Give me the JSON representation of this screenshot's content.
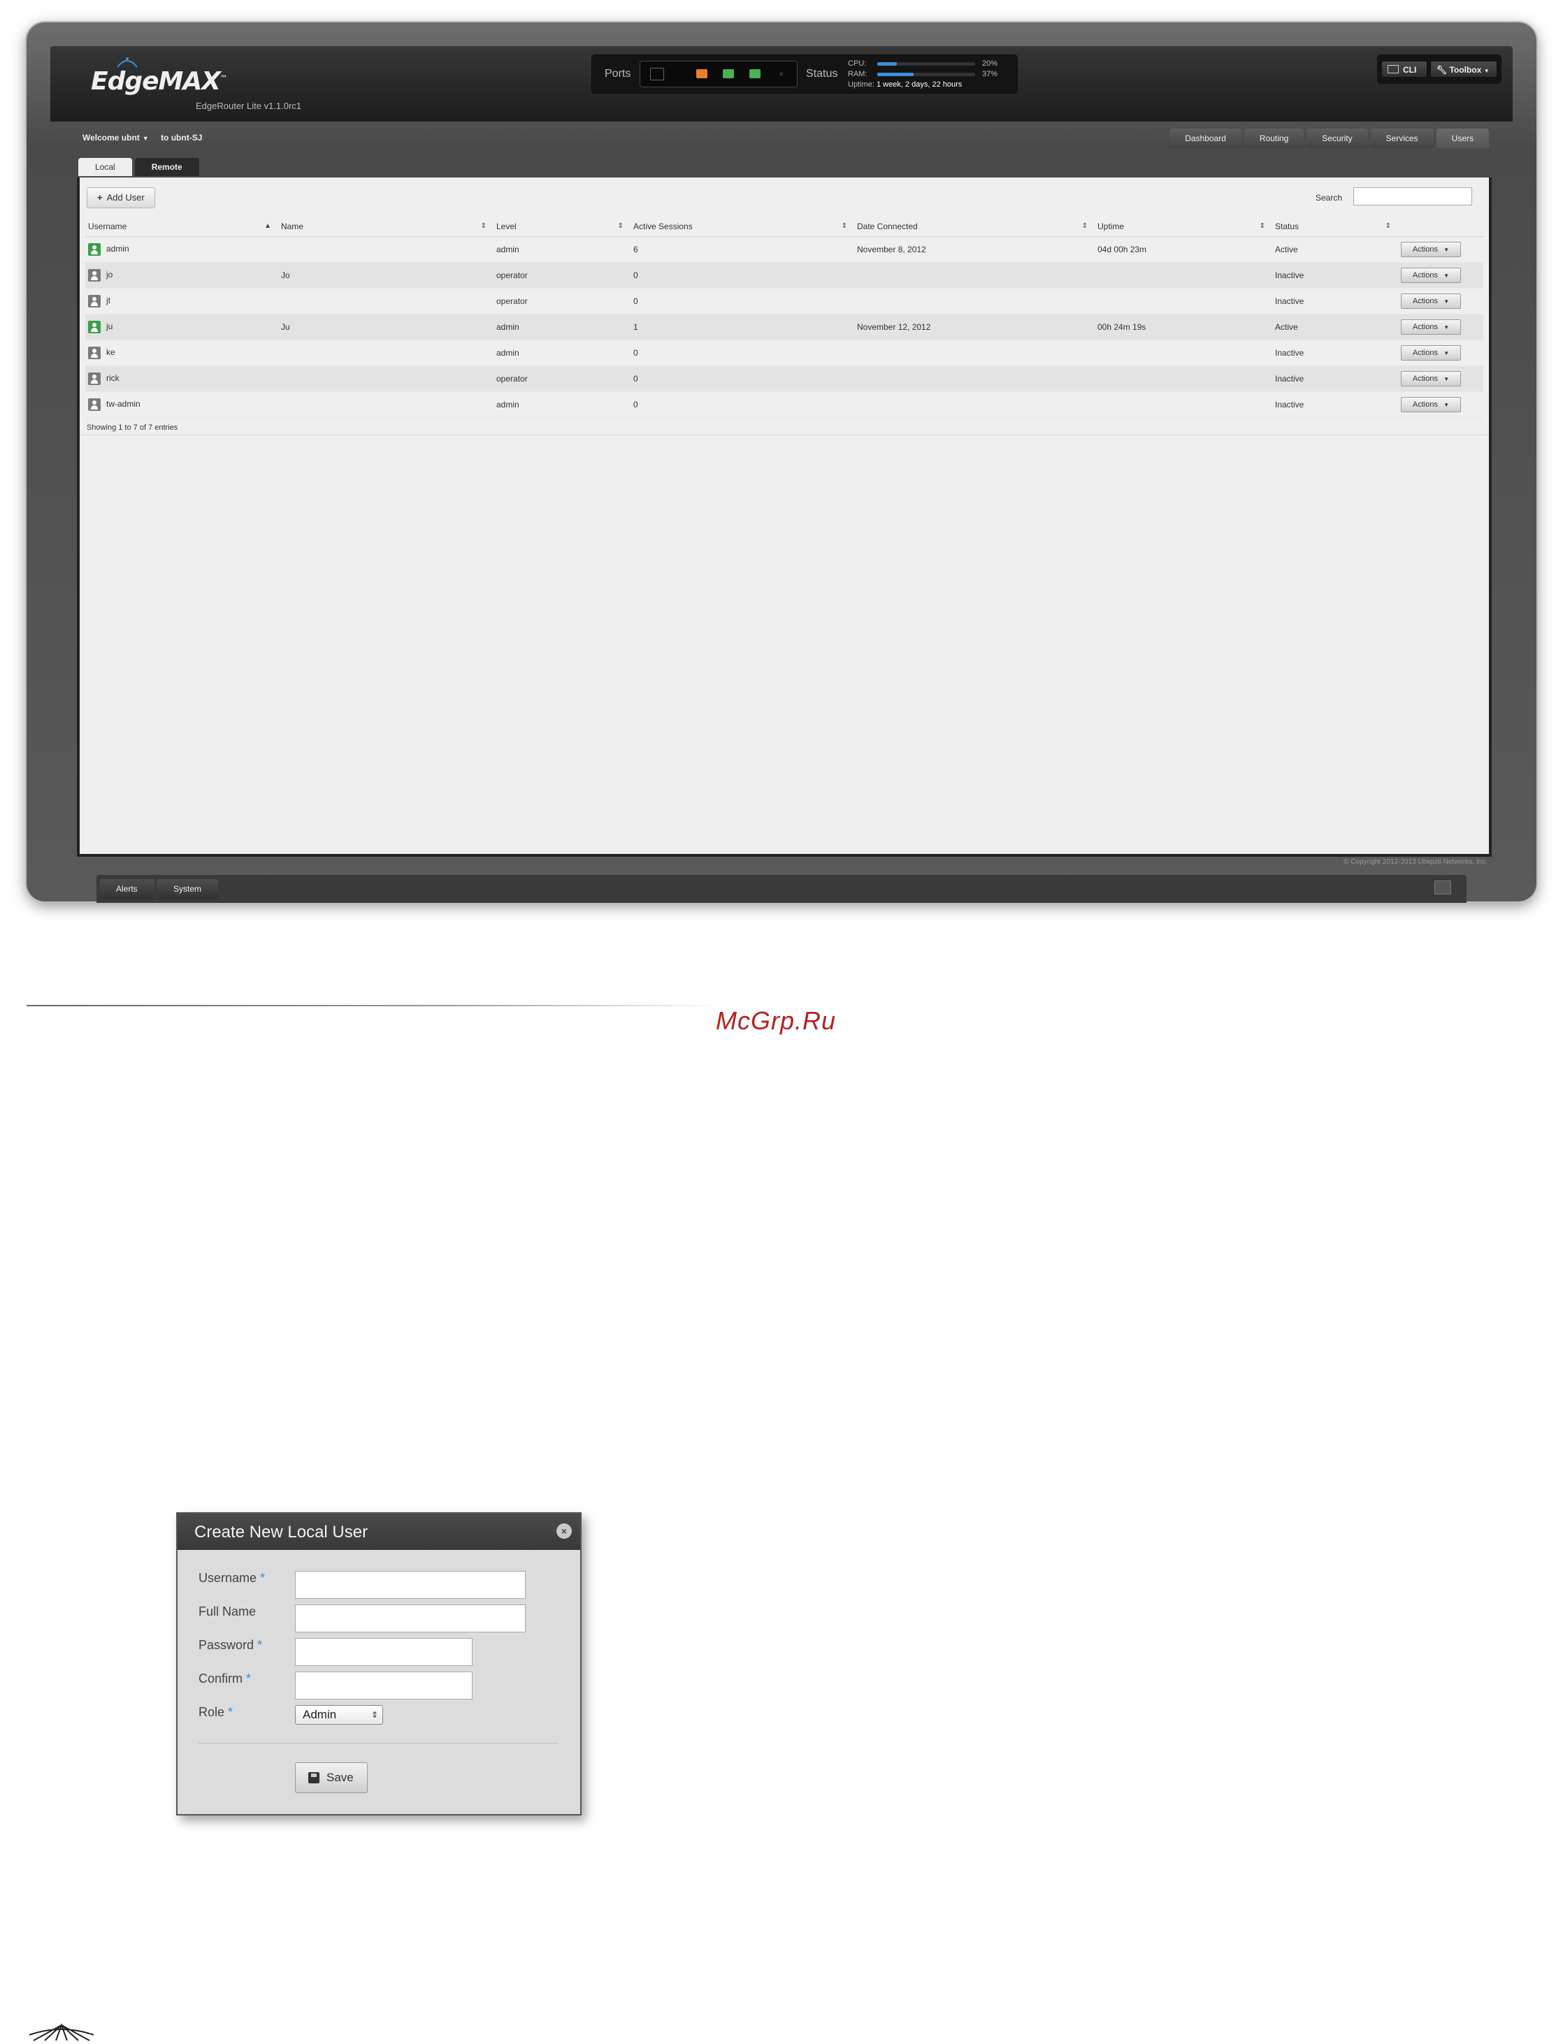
{
  "header": {
    "brand": "EdgeMAX",
    "brand_tm": "™",
    "model": "EdgeRouter Lite v1.1.0rc1",
    "ports_label": "Ports",
    "status_label": "Status",
    "cpu_label": "CPU:",
    "cpu_value": "20%",
    "cpu_fraction": 0.2,
    "ram_label": "RAM:",
    "ram_value": "37%",
    "ram_fraction": 0.37,
    "uptime_label": "Uptime:",
    "uptime_value": "1 week, 2 days, 22 hours",
    "cli_label": "CLI",
    "toolbox_label": "Toolbox",
    "ports": [
      "ghost",
      "orange",
      "green",
      "green",
      "x"
    ]
  },
  "welcome": {
    "user_text": "Welcome ubnt",
    "router_text": "to ubnt-SJ"
  },
  "main_tabs": [
    "Dashboard",
    "Routing",
    "Security",
    "Services",
    "Users"
  ],
  "sub_tabs": [
    "Local",
    "Remote"
  ],
  "toolbar": {
    "add_user_label": "Add User",
    "search_label": "Search",
    "search_value": ""
  },
  "table": {
    "headers": [
      "Username",
      "Name",
      "Level",
      "Active Sessions",
      "Date Connected",
      "Uptime",
      "Status",
      ""
    ],
    "rows": [
      {
        "username": "admin",
        "name": "",
        "level": "admin",
        "sessions": "6",
        "date": "November 8, 2012",
        "uptime": "04d 00h 23m",
        "status": "Active",
        "action": "Actions"
      },
      {
        "username": "jo",
        "name": "Jo",
        "level": "operator",
        "sessions": "0",
        "date": "",
        "uptime": "",
        "status": "Inactive",
        "action": "Actions"
      },
      {
        "username": "jt",
        "name": "",
        "level": "operator",
        "sessions": "0",
        "date": "",
        "uptime": "",
        "status": "Inactive",
        "action": "Actions"
      },
      {
        "username": "ju",
        "name": "Ju",
        "level": "admin",
        "sessions": "1",
        "date": "November 12, 2012",
        "uptime": "00h 24m 19s",
        "status": "Active",
        "action": "Actions"
      },
      {
        "username": "ke",
        "name": "",
        "level": "admin",
        "sessions": "0",
        "date": "",
        "uptime": "",
        "status": "Inactive",
        "action": "Actions"
      },
      {
        "username": "rick",
        "name": "",
        "level": "operator",
        "sessions": "0",
        "date": "",
        "uptime": "",
        "status": "Inactive",
        "action": "Actions"
      },
      {
        "username": "tw-admin",
        "name": "",
        "level": "admin",
        "sessions": "0",
        "date": "",
        "uptime": "",
        "status": "Inactive",
        "action": "Actions"
      }
    ],
    "showing": "Showing 1 to 7 of 7 entries"
  },
  "footer": {
    "copyright": "© Copyright 2012-2013 Ubiquiti Networks, Inc.",
    "tabs": [
      "Alerts",
      "System"
    ]
  },
  "page": {
    "watermark": "McGrp.Ru"
  },
  "dialog": {
    "title": "Create New Local User",
    "username_label": "Username",
    "fullname_label": "Full Name",
    "password_label": "Password",
    "confirm_label": "Confirm",
    "role_label": "Role",
    "required_mark": "*",
    "role_value": "Admin",
    "save_label": "Save"
  },
  "colors": {
    "active_user": "#37a048",
    "inactive_user": "#7a7a7a",
    "accent": "#3c8fd6",
    "watermark": "#b22222"
  }
}
